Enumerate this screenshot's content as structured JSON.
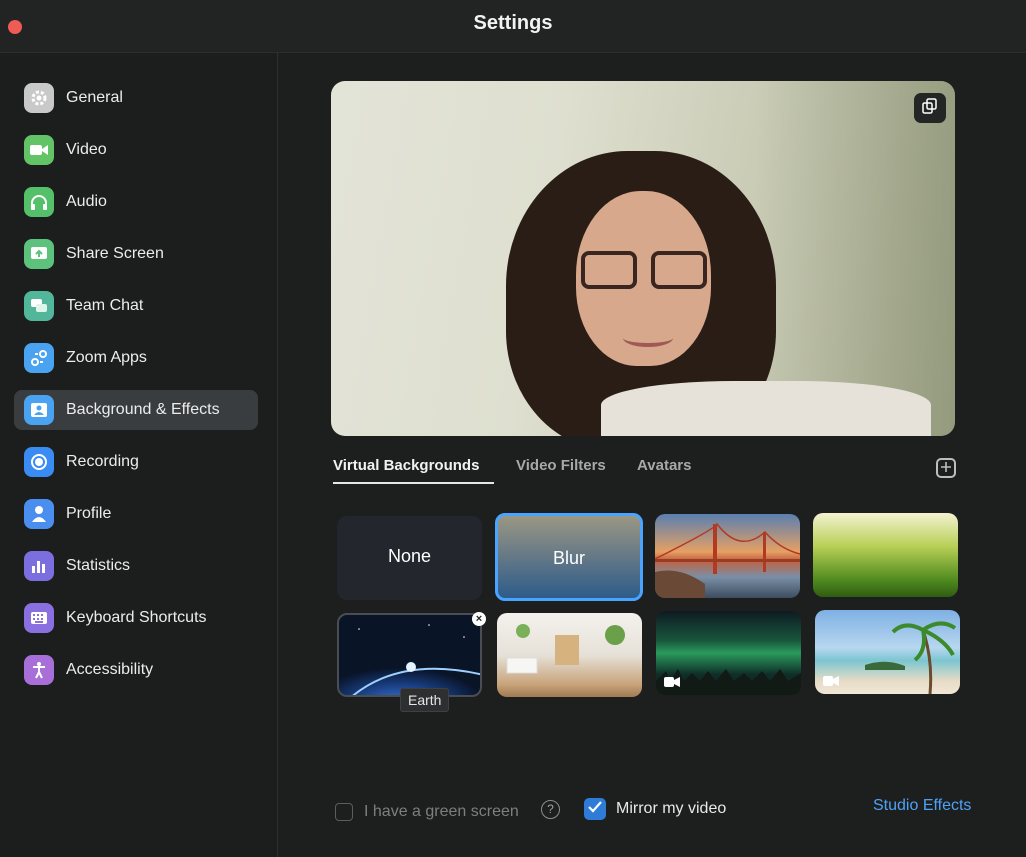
{
  "window": {
    "title": "Settings"
  },
  "sidebar": {
    "items": [
      {
        "label": "General",
        "icon": "gear-icon",
        "color": "#c9c9c9"
      },
      {
        "label": "Video",
        "icon": "video-camera-icon",
        "color": "#62c466"
      },
      {
        "label": "Audio",
        "icon": "headphones-icon",
        "color": "#55c06a"
      },
      {
        "label": "Share Screen",
        "icon": "share-screen-icon",
        "color": "#5cc27c"
      },
      {
        "label": "Team Chat",
        "icon": "chat-bubbles-icon",
        "color": "#52b79a"
      },
      {
        "label": "Zoom Apps",
        "icon": "apps-icon",
        "color": "#4aa3f0"
      },
      {
        "label": "Background & Effects",
        "icon": "portrait-icon",
        "color": "#4aa3f0"
      },
      {
        "label": "Recording",
        "icon": "record-icon",
        "color": "#3a8cf2"
      },
      {
        "label": "Profile",
        "icon": "person-icon",
        "color": "#4a8ff0"
      },
      {
        "label": "Statistics",
        "icon": "bar-chart-icon",
        "color": "#7b6fe0"
      },
      {
        "label": "Keyboard Shortcuts",
        "icon": "keyboard-icon",
        "color": "#8a6fe0"
      },
      {
        "label": "Accessibility",
        "icon": "accessibility-icon",
        "color": "#a86fd8"
      }
    ],
    "active_index": 6
  },
  "main": {
    "tabs": [
      {
        "label": "Virtual Backgrounds"
      },
      {
        "label": "Video Filters"
      },
      {
        "label": "Avatars"
      }
    ],
    "active_tab": 0,
    "backgrounds": [
      {
        "label": "None"
      },
      {
        "label": "Blur"
      },
      {
        "label": ""
      },
      {
        "label": ""
      },
      {
        "label": ""
      },
      {
        "label": ""
      },
      {
        "label": ""
      },
      {
        "label": ""
      }
    ],
    "tooltip": "Earth",
    "green_screen_label": "I have a green screen",
    "green_screen_checked": false,
    "mirror_label": "Mirror my video",
    "mirror_checked": true,
    "studio_effects_label": "Studio Effects"
  }
}
